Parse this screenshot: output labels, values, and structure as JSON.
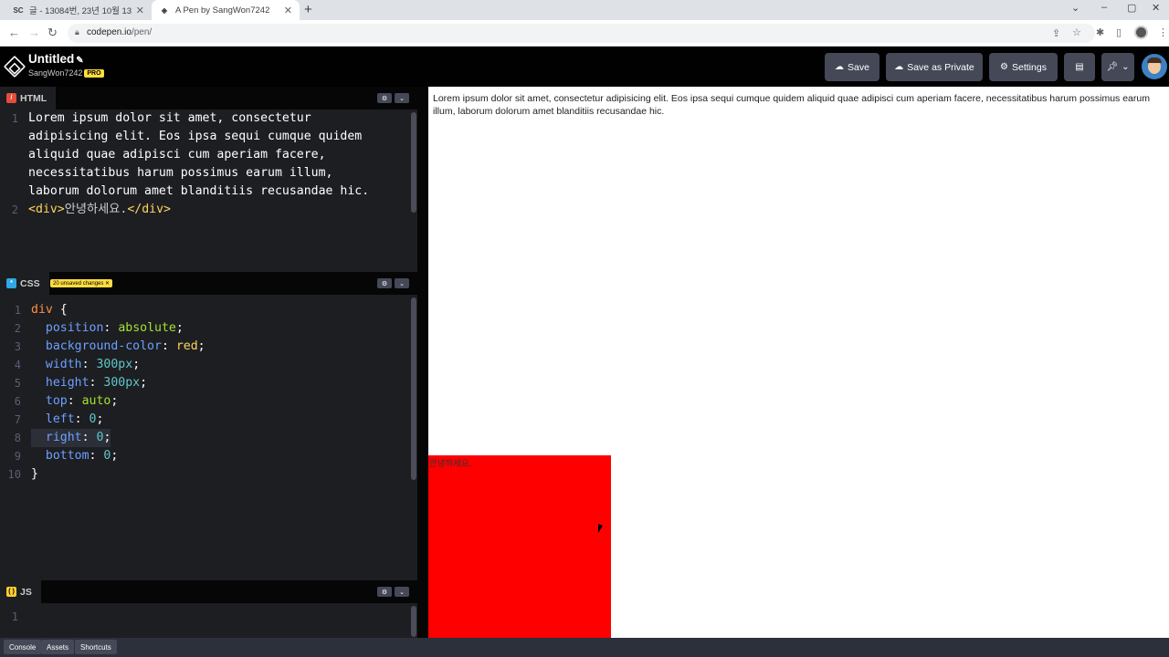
{
  "browser": {
    "tabs": [
      {
        "favicon": "SC",
        "title": "글 - 13084번, 23년 10월 13일 ...",
        "close": "✕"
      },
      {
        "favicon": "◈",
        "title": "A Pen by SangWon7242",
        "close": "✕"
      }
    ],
    "new_tab": "+",
    "window_controls": [
      "⌄",
      "–",
      "▢",
      "✕"
    ],
    "url_host": "codepen.io",
    "url_path": "/pen/"
  },
  "header": {
    "title": "Untitled",
    "title_icon": "pencil-icon",
    "username": "SangWon7242",
    "pro_badge": "PRO",
    "save_label": "Save",
    "save_private_label": "Save as Private",
    "settings_label": "Settings"
  },
  "html_panel": {
    "label": "HTML",
    "lines": [
      "Lorem ipsum dolor sit amet, consectetur",
      "adipisicing elit. Eos ipsa sequi cumque quidem",
      "aliquid quae adipisci cum aperiam facere,",
      "necessitatibus harum possimus earum illum,",
      "laborum dolorum amet blanditiis recusandae hic.",
      "<div>안녕하세요.</div>"
    ],
    "line_numbers": [
      "1",
      "2"
    ]
  },
  "css_panel": {
    "label": "CSS",
    "unsaved": "20 unsaved changes ✕",
    "line_numbers": [
      "1",
      "2",
      "3",
      "4",
      "5",
      "6",
      "7",
      "8",
      "9",
      "10"
    ]
  },
  "js_panel": {
    "label": "JS",
    "line_numbers": [
      "1"
    ]
  },
  "preview": {
    "paragraph": "Lorem ipsum dolor sit amet, consectetur adipisicing elit. Eos ipsa sequi cumque quidem aliquid quae adipisci cum aperiam facere, necessitatibus harum possimus earum illum, laborum dolorum amet blanditiis recusandae hic.",
    "box_text": "안녕하세요.",
    "box_color": "#ff0000"
  },
  "footer": {
    "console": "Console",
    "assets": "Assets",
    "shortcuts": "Shortcuts"
  }
}
